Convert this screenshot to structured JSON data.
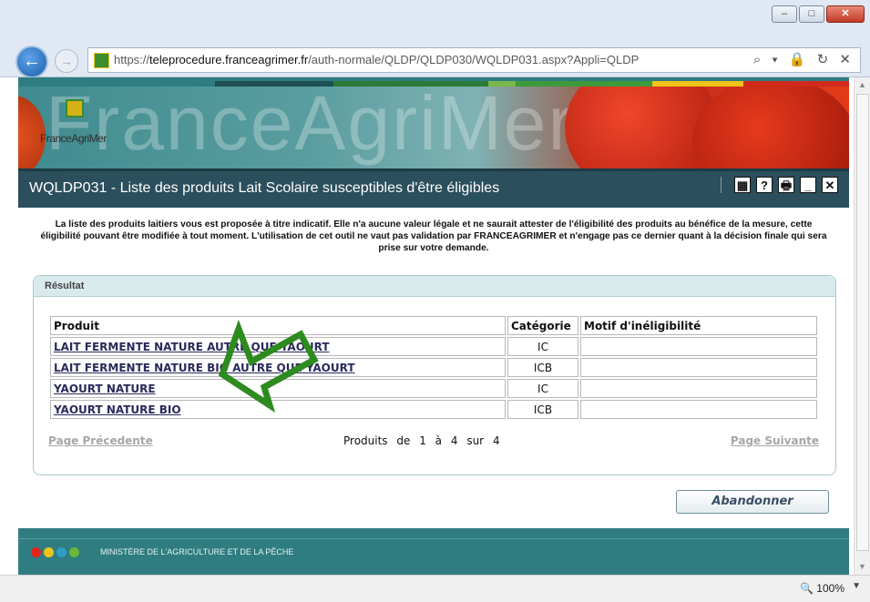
{
  "browser": {
    "url_prefix": "https://",
    "url_domain": "teleprocedure.franceagrimer.fr",
    "url_path": "/auth-normale/QLDP/QLDP030/WQLDP031.aspx?Appli=QLDP",
    "back_icon": "back-arrow-icon",
    "forward_icon": "forward-arrow-icon",
    "url_tools": "⌕ ▾ 🔒 ↻ ✕",
    "zoom": "100%"
  },
  "banner": {
    "logo_text": "FranceAgriMer",
    "watermark": "FranceAgriMer"
  },
  "header": {
    "title": "WQLDP031 - Liste des produits Lait Scolaire susceptibles d'être éligibles",
    "icons": [
      "calculator-icon",
      "help-icon",
      "print-icon",
      "minimize-icon",
      "close-icon"
    ],
    "icon_glyphs": [
      "▦",
      "?",
      "🖶",
      "_",
      "✕"
    ]
  },
  "disclaimer": "La liste des produits laitiers vous est proposée à titre indicatif. Elle n'a aucune valeur légale et ne saurait attester de l'éligibilité des produits au bénéfice de la mesure, cette éligibilité pouvant être modifiée à tout moment. L'utilisation de cet outil ne vaut pas validation par FRANCEAGRIMER et n'engage pas ce dernier quant à la décision finale qui sera prise sur votre demande.",
  "result": {
    "heading": "Résultat",
    "columns": [
      "Produit",
      "Catégorie",
      "Motif d'inéligibilité"
    ],
    "rows": [
      {
        "product": "LAIT FERMENTE NATURE AUTRE QUE YAOURT",
        "category": "IC",
        "reason": ""
      },
      {
        "product": "LAIT FERMENTE NATURE BIO AUTRE QUE YAOURT",
        "category": "ICB",
        "reason": ""
      },
      {
        "product": "YAOURT NATURE",
        "category": "IC",
        "reason": ""
      },
      {
        "product": "YAOURT NATURE BIO",
        "category": "ICB",
        "reason": ""
      }
    ],
    "pager": {
      "prev": "Page Précedente",
      "next": "Page Suivante",
      "count_label": "Produits de",
      "from": "1",
      "to_label": "à",
      "to": "4",
      "of_label": "sur",
      "total": "4"
    }
  },
  "actions": {
    "abandon": "Abandonner"
  },
  "footer": {
    "text": "MINISTÈRE DE L'AGRICULTURE ET DE LA PÊCHE",
    "dot_colors": [
      "#e0261b",
      "#f2c318",
      "#2f9ec5",
      "#6db83a"
    ]
  },
  "colors": {
    "accent_dark": "#2b4f5c",
    "frame_teal": "#2f7d81",
    "annotation_arrow": "#2e8b1f"
  }
}
